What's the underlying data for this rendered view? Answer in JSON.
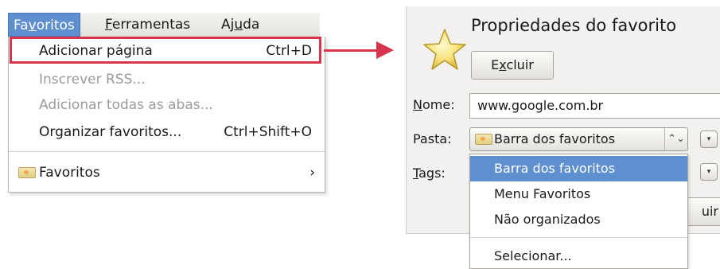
{
  "menubar": {
    "items": [
      {
        "label_pre": "Fa",
        "label_acc": "v",
        "label_post": "oritos"
      },
      {
        "label_pre": "",
        "label_acc": "F",
        "label_post": "erramentas"
      },
      {
        "label_pre": "Aj",
        "label_acc": "u",
        "label_post": "da"
      }
    ]
  },
  "favorites_menu": {
    "items": [
      {
        "label": "Adicionar página",
        "shortcut": "Ctrl+D",
        "enabled": true,
        "highlighted": true
      },
      {
        "label": "Inscrever RSS...",
        "shortcut": "",
        "enabled": false
      },
      {
        "label": "Adicionar todas as abas...",
        "shortcut": "",
        "enabled": false
      },
      {
        "label": "Organizar favoritos...",
        "shortcut": "Ctrl+Shift+O",
        "enabled": true
      }
    ],
    "submenu": {
      "label": "Favoritos",
      "arrow": "›",
      "icon": "folder-icon"
    }
  },
  "colors": {
    "highlight_border": "#d9344d",
    "selection": "#5e8fcf",
    "dialog_bg": "#f2f1ef"
  },
  "dialog": {
    "title": "Propriedades do favorito",
    "icon": "star-icon",
    "delete_button": {
      "label_pre": "E",
      "label_acc": "x",
      "label_post": "cluir"
    },
    "name": {
      "label_pre": "",
      "label_acc": "N",
      "label_post": "ome:",
      "value": "www.google.com.br"
    },
    "folder": {
      "label": "Pasta:",
      "selected": "Barra dos favoritos",
      "toggle_icon": "⌃⌄"
    },
    "tags": {
      "label_pre": "",
      "label_acc": "T",
      "label_post": "ags:"
    },
    "partial_button_label": "uir",
    "folder_options": [
      {
        "label": "Barra dos favoritos",
        "selected": true
      },
      {
        "label": "Menu Favoritos",
        "selected": false
      },
      {
        "label": "Não organizados",
        "selected": false
      },
      {
        "label": "Selecionar...",
        "selected": false
      }
    ]
  }
}
